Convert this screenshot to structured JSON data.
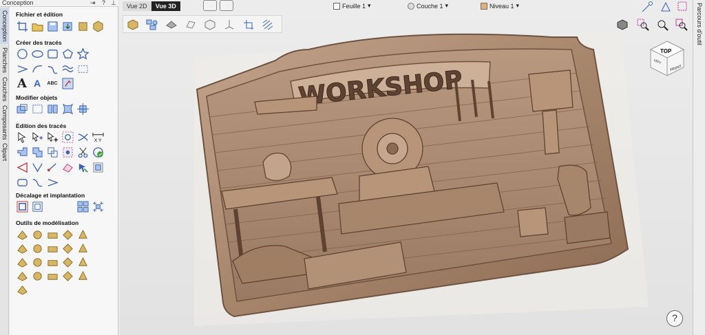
{
  "panel": {
    "title": "Conception",
    "controls": {
      "dock": "⇥",
      "help": "?",
      "pin": "⊥"
    }
  },
  "left_tabs": [
    "Conception",
    "Planches",
    "Couches",
    "Composants",
    "Clipart"
  ],
  "sections": {
    "file": "Fichier et édition",
    "create": "Créer des tracés",
    "modify": "Modifier objets",
    "edit": "Edition des tracés",
    "offset": "Décalage et implantation",
    "modeling": "Outils de modélisation"
  },
  "create_text": {
    "a": "A",
    "abc": "ABC"
  },
  "view_tabs": {
    "v2d": "Vue 2D",
    "v3d": "Vue 3D"
  },
  "dropdowns": {
    "sheet": "Feuille 1",
    "layer": "Couche 1",
    "level": "Niveau 1"
  },
  "right_tab": "Parcours d'outil",
  "model": {
    "title": "WORKSHOP"
  },
  "view_cube": {
    "top": "TOP",
    "front": "FRONT",
    "left": "LEFT"
  },
  "help_label": "?",
  "colors": {
    "relief": "#b08f76",
    "accent_blue": "#3a63b5",
    "gold": "#d9b566"
  },
  "icons": {
    "file_tools": [
      "crop-icon",
      "open-folder-icon",
      "save-icon",
      "import-icon",
      "export-icon",
      "clipart-icon"
    ],
    "create_tools": [
      "circle-icon",
      "ellipse-icon",
      "rectangle-icon",
      "polygon-icon",
      "star-icon",
      "polyline-icon",
      "arc-icon",
      "curve-icon",
      "wave-icon",
      "dimension-icon",
      "text-icon",
      "text-on-curve-icon",
      "text-arc-icon",
      "bitmap-trace-icon"
    ],
    "modify_tools": [
      "scale-icon",
      "align-left-icon",
      "align-center-icon",
      "distort-icon",
      "align-objects-icon"
    ],
    "edit_tools": [
      "node-edit-icon",
      "node-add-icon",
      "transform-icon",
      "join-icon",
      "trim-icon",
      "measure-icon",
      "weld-icon",
      "subtract-icon",
      "intersect-icon",
      "boundary-icon",
      "cut-icon",
      "validate-icon",
      "fillet-icon",
      "chamfer-icon",
      "extend-icon",
      "flip-icon",
      "bitmap-icon",
      "spline-icon",
      "smooth-icon",
      "rounded-rect-icon",
      "curve-fit-icon"
    ],
    "offset_tools": [
      "offset-icon",
      "nest-icon",
      "array-icon",
      "grid-array-icon"
    ],
    "modeling_tools": 21
  }
}
